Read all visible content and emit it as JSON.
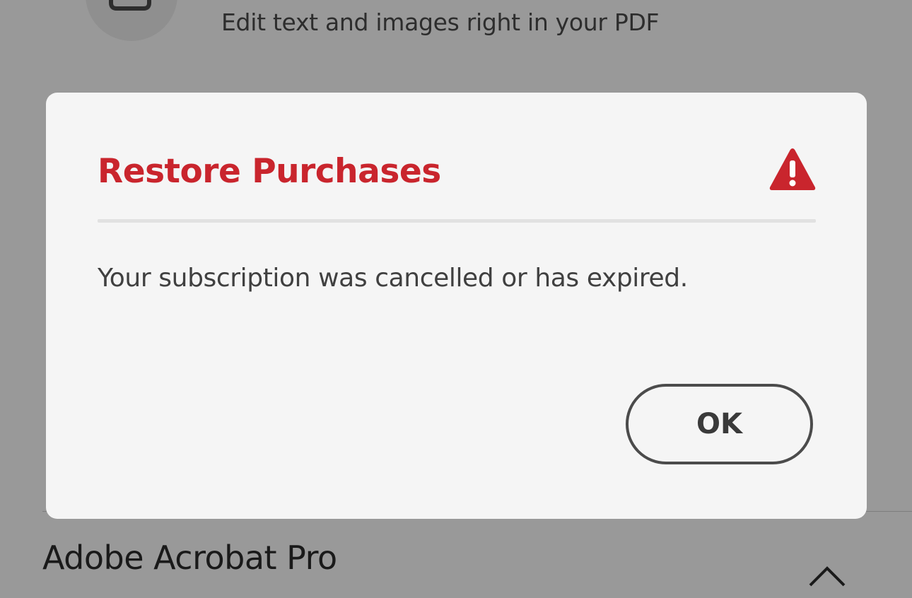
{
  "background": {
    "feature_description": "Edit text and images right in your PDF",
    "plan": {
      "title": "Adobe Acrobat Pro"
    },
    "icons": {
      "feature_icon": "edit-pdf-icon",
      "collapse_icon": "chevron-up-icon"
    }
  },
  "dialog": {
    "title": "Restore Purchases",
    "icon": "warning-icon",
    "message": "Your subscription was cancelled or has expired.",
    "ok_label": "OK",
    "colors": {
      "title": "#c9252d",
      "icon": "#c9252d",
      "background": "#f5f5f5"
    }
  }
}
